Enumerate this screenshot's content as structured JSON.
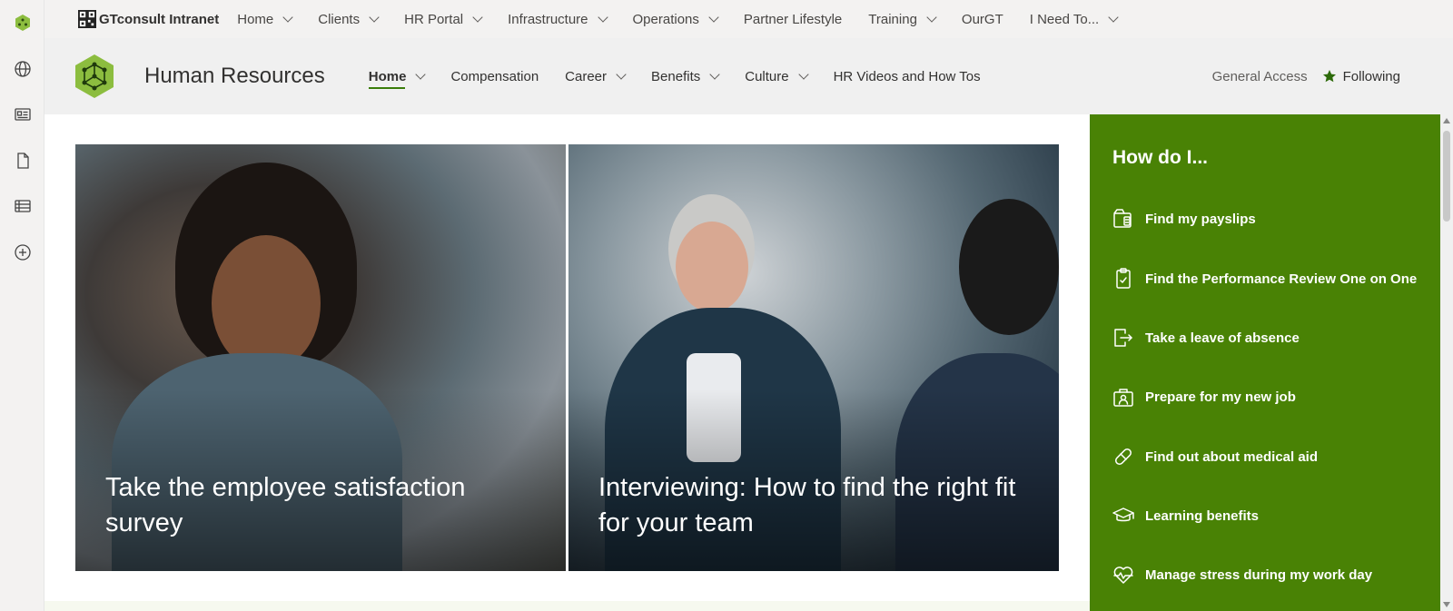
{
  "hub": {
    "title": "GTconsult Intranet",
    "items": [
      {
        "label": "Home",
        "dropdown": true
      },
      {
        "label": "Clients",
        "dropdown": true
      },
      {
        "label": "HR Portal",
        "dropdown": true
      },
      {
        "label": "Infrastructure",
        "dropdown": true
      },
      {
        "label": "Operations",
        "dropdown": true
      },
      {
        "label": "Partner Lifestyle",
        "dropdown": false
      },
      {
        "label": "Training",
        "dropdown": true
      },
      {
        "label": "OurGT",
        "dropdown": false
      },
      {
        "label": "I Need To...",
        "dropdown": true
      }
    ]
  },
  "site": {
    "title": "Human Resources",
    "nav": [
      {
        "label": "Home",
        "dropdown": true,
        "active": true
      },
      {
        "label": "Compensation",
        "dropdown": false
      },
      {
        "label": "Career",
        "dropdown": true
      },
      {
        "label": "Benefits",
        "dropdown": true
      },
      {
        "label": "Culture",
        "dropdown": true
      },
      {
        "label": "HR Videos and How Tos",
        "dropdown": false
      }
    ],
    "general_access": "General Access",
    "following": "Following"
  },
  "hero": [
    {
      "caption": "Take the employee satisfaction survey"
    },
    {
      "caption": "Interviewing: How to find the right fit for your team"
    }
  ],
  "how_do_i": {
    "title": "How do I...",
    "links": [
      {
        "label": "Find my payslips",
        "icon": "payslip-icon"
      },
      {
        "label": "Find the Performance Review One on One",
        "icon": "clipboard-icon"
      },
      {
        "label": "Take a leave of absence",
        "icon": "leave-icon"
      },
      {
        "label": "Prepare for my new job",
        "icon": "new-job-icon"
      },
      {
        "label": "Find out about medical aid",
        "icon": "pill-icon"
      },
      {
        "label": "Learning benefits",
        "icon": "graduation-cap-icon"
      },
      {
        "label": "Manage stress during my work day",
        "icon": "heartbeat-icon"
      }
    ]
  },
  "colors": {
    "accent_green": "#498205",
    "logo_green": "#8cbd3f"
  }
}
